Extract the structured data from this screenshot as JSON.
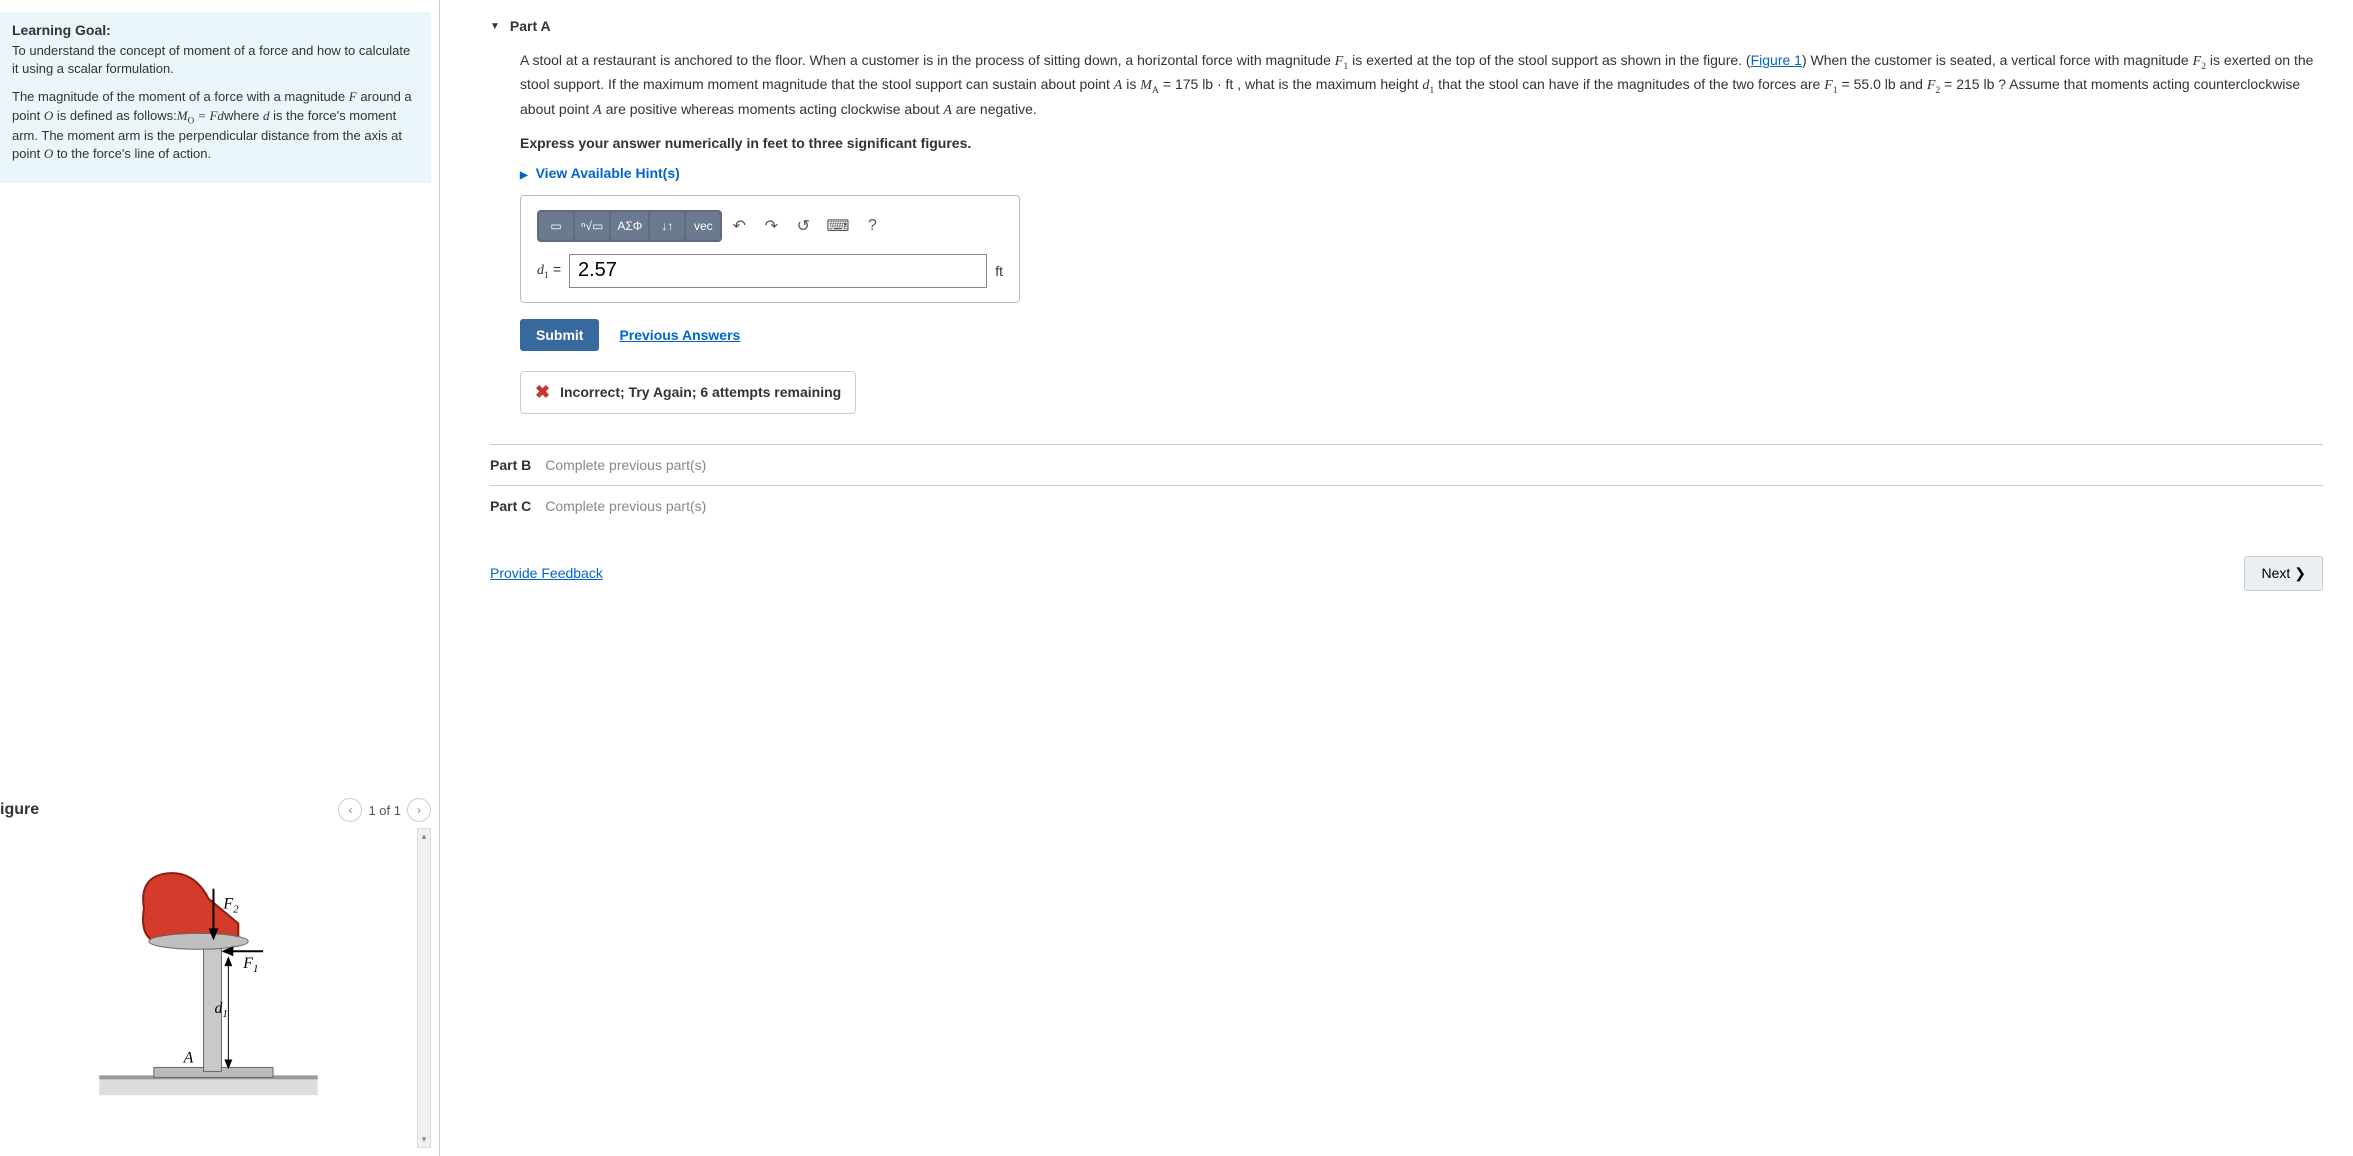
{
  "left": {
    "learning_goal_heading": "Learning Goal:",
    "learning_goal_p1": "To understand the concept of moment of a force and how to calculate it using a scalar formulation.",
    "learning_goal_p2_a": "The magnitude of the moment of a force with a magnitude ",
    "learning_goal_p2_b": " around a point ",
    "learning_goal_p2_c": " is defined as follows:",
    "learning_goal_p2_d": "where ",
    "learning_goal_p2_e": " is the force's moment arm. The moment arm is the perpendicular distance from the axis at point ",
    "learning_goal_p2_f": " to the force's line of action.",
    "sym_F": "F",
    "sym_O": "O",
    "sym_MO": "M",
    "sym_MO_sub": "O",
    "sym_eq": " = ",
    "sym_Fd": "Fd",
    "sym_d": "d",
    "figure_title": "igure",
    "figure_counter": "1 of 1",
    "fig_F1": "F",
    "fig_F1_sub": "1",
    "fig_F2": "F",
    "fig_F2_sub": "2",
    "fig_d1": "d",
    "fig_d1_sub": "1",
    "fig_A": "A"
  },
  "right": {
    "partA_title": "Part A",
    "problem_1": "A stool at a restaurant is anchored to the floor. When a customer is in the process of sitting down, a horizontal force with magnitude ",
    "problem_2": " is exerted at the top of the stool support as shown in the figure. (",
    "figure_link": "Figure 1",
    "problem_3": ") When the customer is seated, a vertical force with magnitude ",
    "problem_4": " is exerted on the stool support. If the maximum moment magnitude that the stool support can sustain about point ",
    "problem_5": " is ",
    "MA_val": " = 175 lb · ft",
    "problem_6": " , what is the maximum height ",
    "problem_7": " that the stool can have if the magnitudes of the two forces are ",
    "F1_val": " = 55.0 lb",
    "problem_8": " and ",
    "F2_val": " = 215 lb",
    "problem_9": " ? Assume that moments acting counterclockwise about point ",
    "problem_10": " are positive whereas moments acting clockwise about ",
    "problem_11": " are negative.",
    "sym_F1": "F",
    "sym_F1_sub": "1",
    "sym_F2": "F",
    "sym_F2_sub": "2",
    "sym_A": "A",
    "sym_MA": "M",
    "sym_MA_sub": "A",
    "sym_d1": "d",
    "sym_d1_sub": "1",
    "express": "Express your answer numerically in feet to three significant figures.",
    "hints": "View Available Hint(s)",
    "toolbar": {
      "greek": "ΑΣΦ",
      "vec": "vec",
      "help": "?"
    },
    "answer_label_var": "d",
    "answer_label_sub": "1",
    "answer_label_eq": " = ",
    "answer_value": "2.57",
    "answer_unit": "ft",
    "submit": "Submit",
    "prev_answers": "Previous Answers",
    "incorrect": "Incorrect; Try Again; 6 attempts remaining",
    "partB_label": "Part B",
    "partB_msg": "Complete previous part(s)",
    "partC_label": "Part C",
    "partC_msg": "Complete previous part(s)",
    "provide_feedback": "Provide Feedback",
    "next": "Next"
  }
}
